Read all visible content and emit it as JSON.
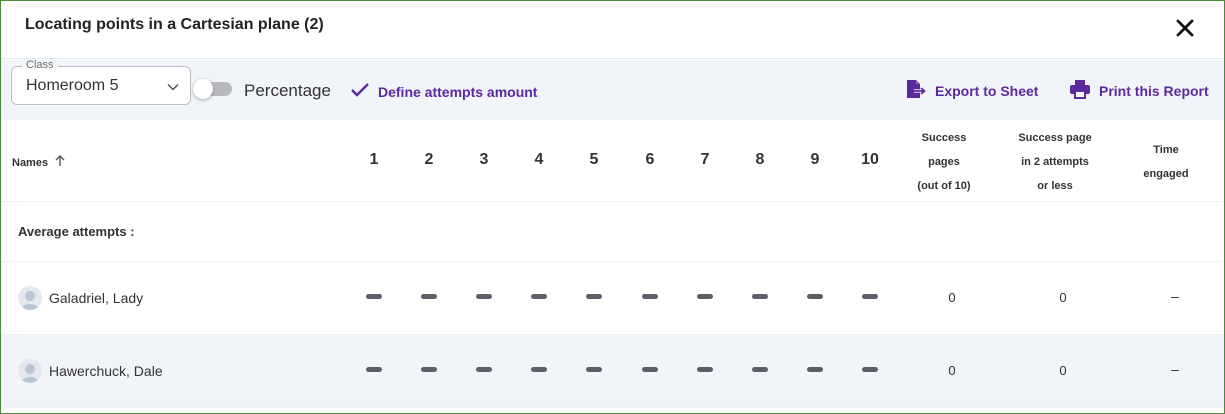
{
  "header": {
    "title": "Locating points in a Cartesian plane (2)"
  },
  "toolbar": {
    "class_legend": "Class",
    "class_value": "Homeroom 5",
    "percentage_label": "Percentage",
    "percentage_on": false,
    "define_label": "Define attempts amount",
    "export_label": "Export to Sheet",
    "print_label": "Print this Report"
  },
  "colors": {
    "accent": "#5b2a9e",
    "toolbar_bg": "#f1f4f9",
    "dash": "#5b6068"
  },
  "table": {
    "names_header": "Names",
    "page_columns": [
      "1",
      "2",
      "3",
      "4",
      "5",
      "6",
      "7",
      "8",
      "9",
      "10"
    ],
    "success_header": [
      "Success",
      "pages",
      "(out of 10)"
    ],
    "success2_header": [
      "Success page",
      "in 2 attempts",
      "or less"
    ],
    "time_header": [
      "Time",
      "engaged"
    ],
    "average_label": "Average attempts :",
    "students": [
      {
        "name": "Galadriel, Lady",
        "success_pages": "0",
        "success_2": "0",
        "time": "–"
      },
      {
        "name": "Hawerchuck, Dale",
        "success_pages": "0",
        "success_2": "0",
        "time": "–"
      }
    ]
  }
}
